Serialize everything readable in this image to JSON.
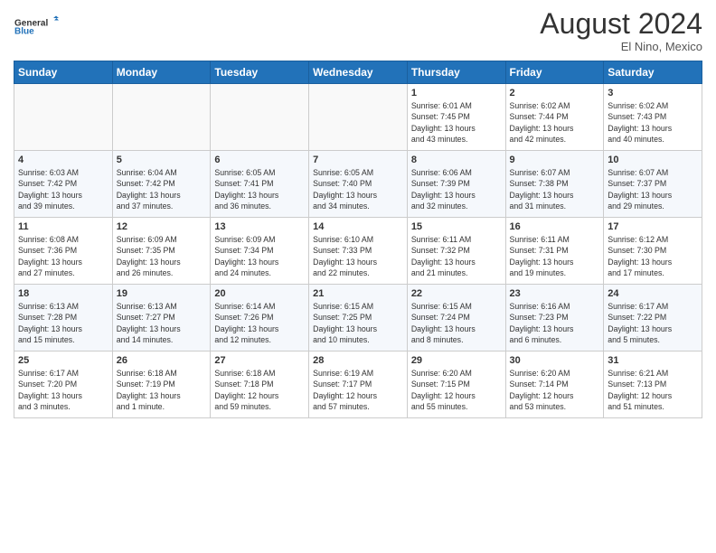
{
  "header": {
    "logo_general": "General",
    "logo_blue": "Blue",
    "month_year": "August 2024",
    "location": "El Nino, Mexico"
  },
  "days_of_week": [
    "Sunday",
    "Monday",
    "Tuesday",
    "Wednesday",
    "Thursday",
    "Friday",
    "Saturday"
  ],
  "weeks": [
    [
      {
        "day": "",
        "info": ""
      },
      {
        "day": "",
        "info": ""
      },
      {
        "day": "",
        "info": ""
      },
      {
        "day": "",
        "info": ""
      },
      {
        "day": "1",
        "info": "Sunrise: 6:01 AM\nSunset: 7:45 PM\nDaylight: 13 hours\nand 43 minutes."
      },
      {
        "day": "2",
        "info": "Sunrise: 6:02 AM\nSunset: 7:44 PM\nDaylight: 13 hours\nand 42 minutes."
      },
      {
        "day": "3",
        "info": "Sunrise: 6:02 AM\nSunset: 7:43 PM\nDaylight: 13 hours\nand 40 minutes."
      }
    ],
    [
      {
        "day": "4",
        "info": "Sunrise: 6:03 AM\nSunset: 7:42 PM\nDaylight: 13 hours\nand 39 minutes."
      },
      {
        "day": "5",
        "info": "Sunrise: 6:04 AM\nSunset: 7:42 PM\nDaylight: 13 hours\nand 37 minutes."
      },
      {
        "day": "6",
        "info": "Sunrise: 6:05 AM\nSunset: 7:41 PM\nDaylight: 13 hours\nand 36 minutes."
      },
      {
        "day": "7",
        "info": "Sunrise: 6:05 AM\nSunset: 7:40 PM\nDaylight: 13 hours\nand 34 minutes."
      },
      {
        "day": "8",
        "info": "Sunrise: 6:06 AM\nSunset: 7:39 PM\nDaylight: 13 hours\nand 32 minutes."
      },
      {
        "day": "9",
        "info": "Sunrise: 6:07 AM\nSunset: 7:38 PM\nDaylight: 13 hours\nand 31 minutes."
      },
      {
        "day": "10",
        "info": "Sunrise: 6:07 AM\nSunset: 7:37 PM\nDaylight: 13 hours\nand 29 minutes."
      }
    ],
    [
      {
        "day": "11",
        "info": "Sunrise: 6:08 AM\nSunset: 7:36 PM\nDaylight: 13 hours\nand 27 minutes."
      },
      {
        "day": "12",
        "info": "Sunrise: 6:09 AM\nSunset: 7:35 PM\nDaylight: 13 hours\nand 26 minutes."
      },
      {
        "day": "13",
        "info": "Sunrise: 6:09 AM\nSunset: 7:34 PM\nDaylight: 13 hours\nand 24 minutes."
      },
      {
        "day": "14",
        "info": "Sunrise: 6:10 AM\nSunset: 7:33 PM\nDaylight: 13 hours\nand 22 minutes."
      },
      {
        "day": "15",
        "info": "Sunrise: 6:11 AM\nSunset: 7:32 PM\nDaylight: 13 hours\nand 21 minutes."
      },
      {
        "day": "16",
        "info": "Sunrise: 6:11 AM\nSunset: 7:31 PM\nDaylight: 13 hours\nand 19 minutes."
      },
      {
        "day": "17",
        "info": "Sunrise: 6:12 AM\nSunset: 7:30 PM\nDaylight: 13 hours\nand 17 minutes."
      }
    ],
    [
      {
        "day": "18",
        "info": "Sunrise: 6:13 AM\nSunset: 7:28 PM\nDaylight: 13 hours\nand 15 minutes."
      },
      {
        "day": "19",
        "info": "Sunrise: 6:13 AM\nSunset: 7:27 PM\nDaylight: 13 hours\nand 14 minutes."
      },
      {
        "day": "20",
        "info": "Sunrise: 6:14 AM\nSunset: 7:26 PM\nDaylight: 13 hours\nand 12 minutes."
      },
      {
        "day": "21",
        "info": "Sunrise: 6:15 AM\nSunset: 7:25 PM\nDaylight: 13 hours\nand 10 minutes."
      },
      {
        "day": "22",
        "info": "Sunrise: 6:15 AM\nSunset: 7:24 PM\nDaylight: 13 hours\nand 8 minutes."
      },
      {
        "day": "23",
        "info": "Sunrise: 6:16 AM\nSunset: 7:23 PM\nDaylight: 13 hours\nand 6 minutes."
      },
      {
        "day": "24",
        "info": "Sunrise: 6:17 AM\nSunset: 7:22 PM\nDaylight: 13 hours\nand 5 minutes."
      }
    ],
    [
      {
        "day": "25",
        "info": "Sunrise: 6:17 AM\nSunset: 7:20 PM\nDaylight: 13 hours\nand 3 minutes."
      },
      {
        "day": "26",
        "info": "Sunrise: 6:18 AM\nSunset: 7:19 PM\nDaylight: 13 hours\nand 1 minute."
      },
      {
        "day": "27",
        "info": "Sunrise: 6:18 AM\nSunset: 7:18 PM\nDaylight: 12 hours\nand 59 minutes."
      },
      {
        "day": "28",
        "info": "Sunrise: 6:19 AM\nSunset: 7:17 PM\nDaylight: 12 hours\nand 57 minutes."
      },
      {
        "day": "29",
        "info": "Sunrise: 6:20 AM\nSunset: 7:15 PM\nDaylight: 12 hours\nand 55 minutes."
      },
      {
        "day": "30",
        "info": "Sunrise: 6:20 AM\nSunset: 7:14 PM\nDaylight: 12 hours\nand 53 minutes."
      },
      {
        "day": "31",
        "info": "Sunrise: 6:21 AM\nSunset: 7:13 PM\nDaylight: 12 hours\nand 51 minutes."
      }
    ]
  ]
}
